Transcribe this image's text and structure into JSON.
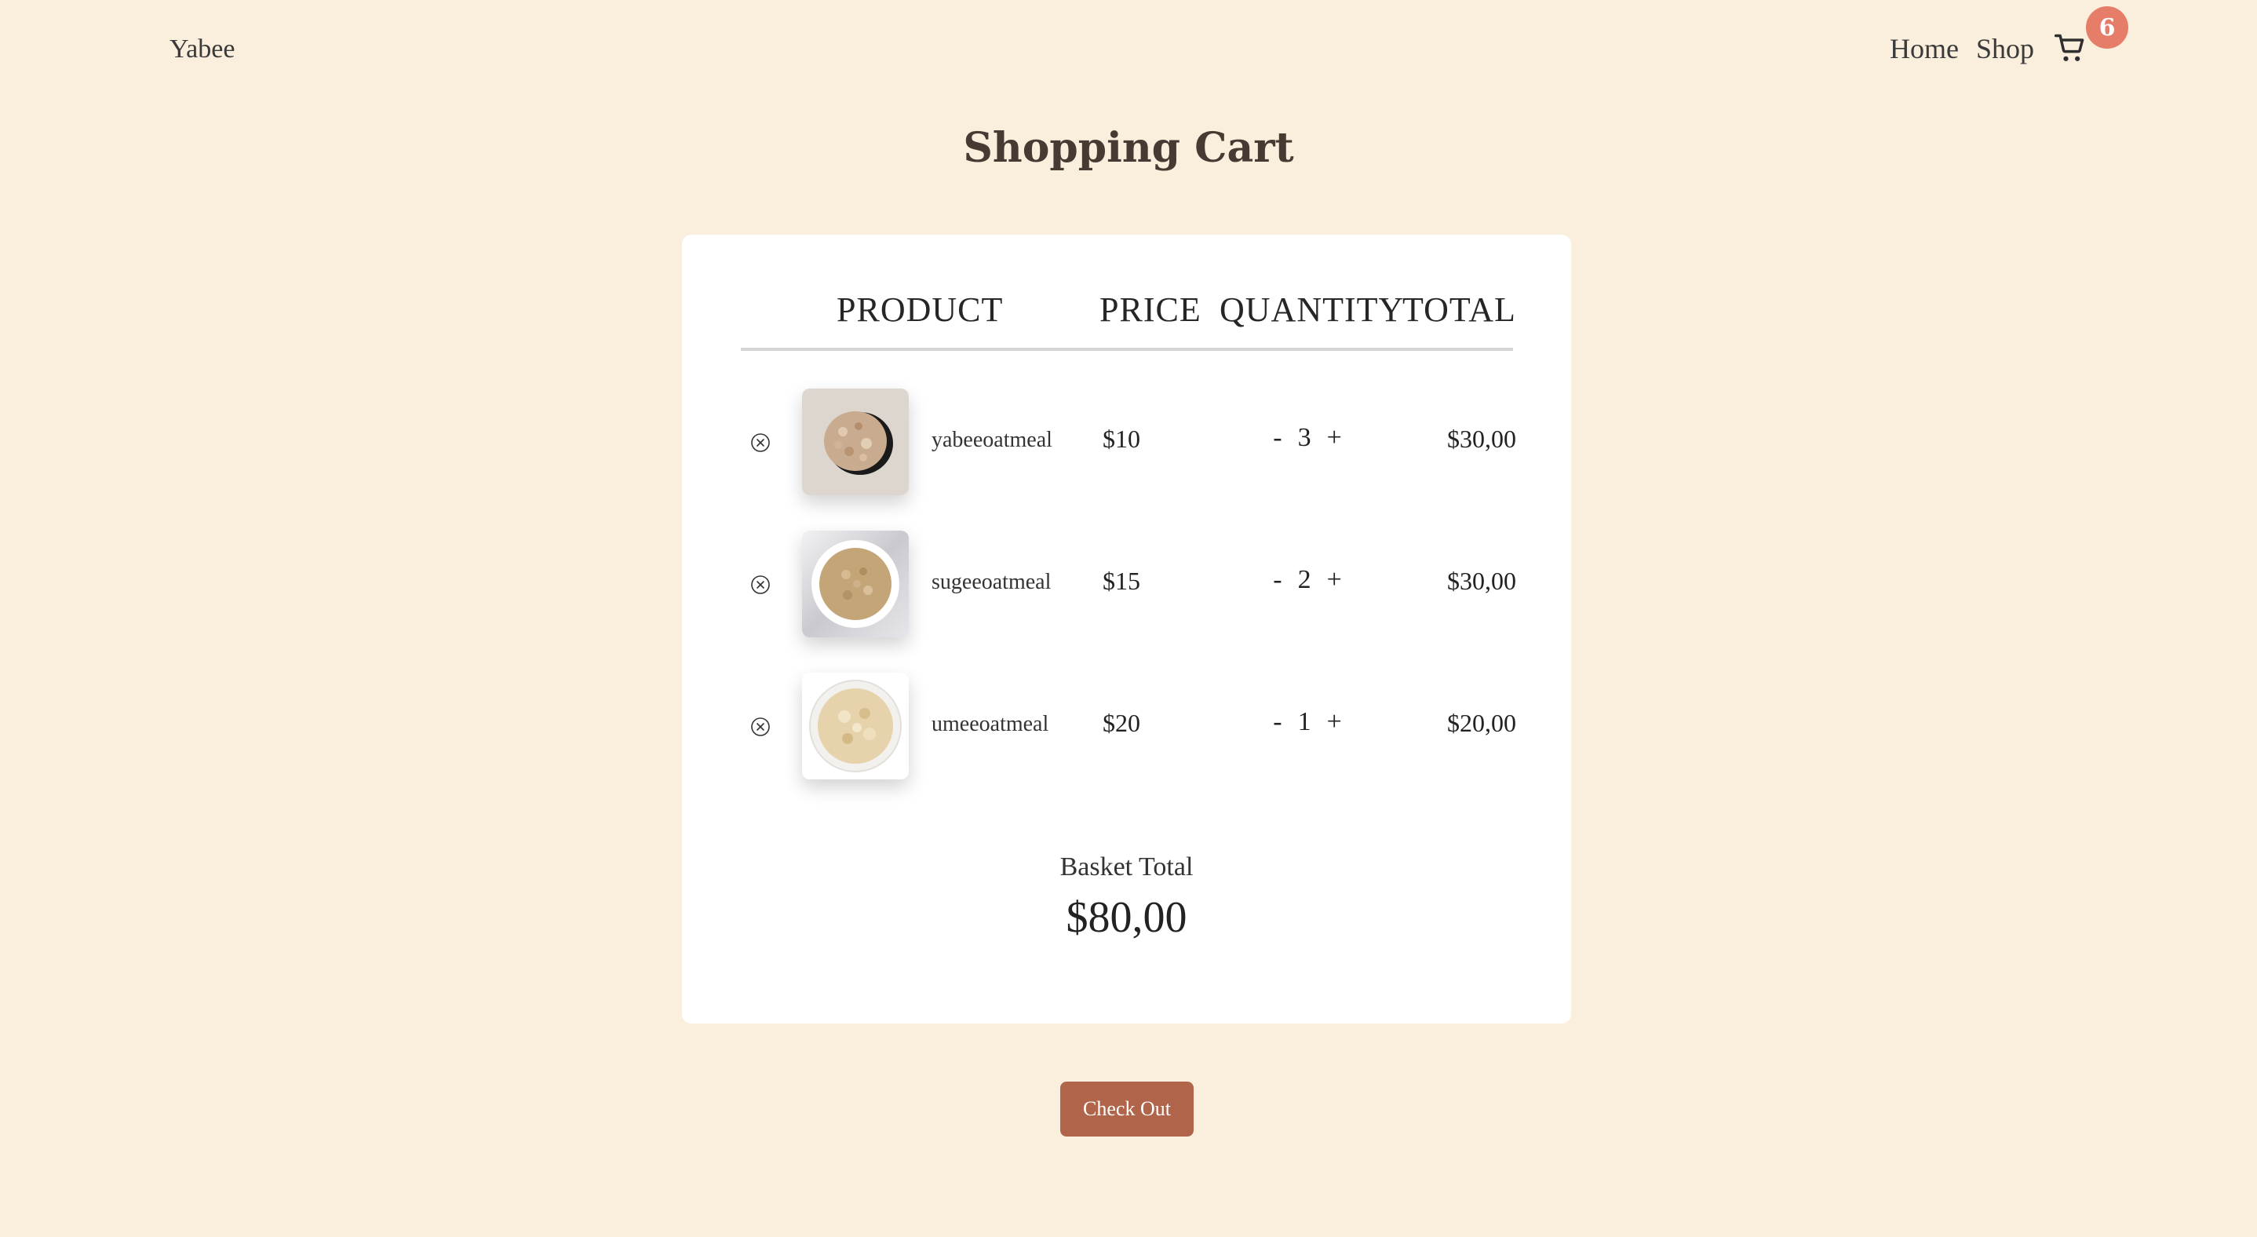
{
  "brand": "Yabee",
  "nav": {
    "home": "Home",
    "shop": "Shop",
    "cart_icon": "shopping-cart-icon",
    "cart_count": "6",
    "badge_color": "#e67d68"
  },
  "page_title": "Shopping Cart",
  "table": {
    "headers": {
      "product": "PRODUCT",
      "price": "PRICE",
      "quantity": "QUANTITY",
      "total": "TOTAL"
    },
    "items": [
      {
        "name": "yabeeoatmeal",
        "price": "$10",
        "quantity": "3",
        "total": "$30,00",
        "remove_icon": "remove-circle-x-icon"
      },
      {
        "name": "sugeeoatmeal",
        "price": "$15",
        "quantity": "2",
        "total": "$30,00",
        "remove_icon": "remove-circle-x-icon"
      },
      {
        "name": "umeeoatmeal",
        "price": "$20",
        "quantity": "1",
        "total": "$20,00",
        "remove_icon": "remove-circle-x-icon"
      }
    ],
    "decrement_label": "-",
    "increment_label": "+"
  },
  "basket": {
    "label": "Basket Total",
    "value": "$80,00"
  },
  "checkout": {
    "label": "Check Out",
    "color": "#b0654a"
  },
  "colors": {
    "page_background": "#faeedd",
    "card_background": "#ffffff"
  }
}
